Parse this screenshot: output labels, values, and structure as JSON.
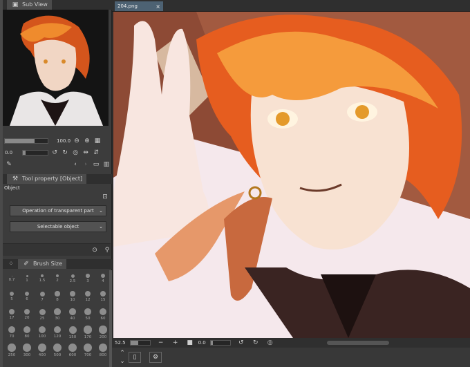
{
  "sub_view": {
    "title": "Sub View",
    "zoom": "100.0",
    "angle": "0.0"
  },
  "file_tab": {
    "name": "204.png"
  },
  "tool_property": {
    "title": "Tool property [Object]",
    "section": "Object",
    "dropdown1": "Operation of transparent part",
    "dropdown2": "Selectable object"
  },
  "brush_size": {
    "title": "Brush Size",
    "sizes": [
      "0.7",
      "1",
      "1.5",
      "2",
      "2.5",
      "3",
      "4",
      "5",
      "6",
      "7",
      "8",
      "10",
      "12",
      "15",
      "17",
      "20",
      "25",
      "30",
      "40",
      "50",
      "60",
      "70",
      "80",
      "100",
      "120",
      "150",
      "170",
      "200",
      "250",
      "300",
      "400",
      "500",
      "600",
      "700",
      "800"
    ]
  },
  "status": {
    "zoom": "52.5",
    "angle": "0.0"
  },
  "colors": {
    "panel": "#3c3c3c",
    "accent": "#4d6273"
  }
}
